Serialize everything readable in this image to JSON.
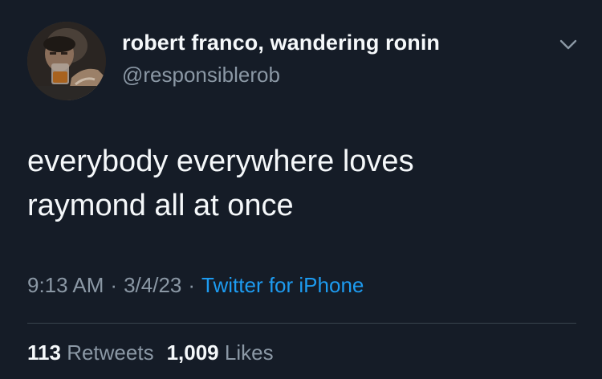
{
  "author": {
    "display_name": "robert franco, wandering ronin",
    "handle": "@responsiblerob",
    "avatar_icon": "profile-photo"
  },
  "menu_icon": "chevron-down-icon",
  "tweet": {
    "text": "everybody everywhere loves\nraymond all at once",
    "time": "9:13 AM",
    "separator": "·",
    "date": "3/4/23",
    "source": "Twitter for iPhone"
  },
  "stats": {
    "retweets_count": "113",
    "retweets_label": "Retweets",
    "likes_count": "1,009",
    "likes_label": "Likes"
  },
  "colors": {
    "background": "#151c27",
    "primary_text": "#f5f8fa",
    "secondary_text": "#8b98a5",
    "link": "#1d9bf0",
    "divider": "#38444d"
  }
}
